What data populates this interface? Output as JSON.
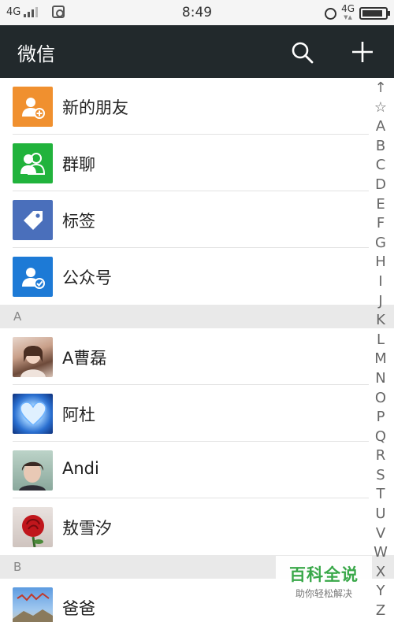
{
  "status_bar": {
    "network_left": "4G",
    "time": "8:49",
    "network_right": "4G"
  },
  "header": {
    "title": "微信"
  },
  "features": [
    {
      "label": "新的朋友",
      "icon": "add-friend-icon",
      "color": "#f0902f"
    },
    {
      "label": "群聊",
      "icon": "group-chat-icon",
      "color": "#21b33c"
    },
    {
      "label": "标签",
      "icon": "tag-icon",
      "color": "#4a6fbb"
    },
    {
      "label": "公众号",
      "icon": "official-account-icon",
      "color": "#1d7ad6"
    }
  ],
  "sections": [
    {
      "letter": "A",
      "contacts": [
        {
          "name": "A曹磊"
        },
        {
          "name": "阿杜"
        },
        {
          "name": "Andi"
        },
        {
          "name": "敖雪汐"
        }
      ]
    },
    {
      "letter": "B",
      "contacts": [
        {
          "name": "爸爸"
        }
      ]
    }
  ],
  "index": [
    "↑",
    "☆",
    "A",
    "B",
    "C",
    "D",
    "E",
    "F",
    "G",
    "H",
    "I",
    "J",
    "K",
    "L",
    "M",
    "N",
    "O",
    "P",
    "Q",
    "R",
    "S",
    "T",
    "U",
    "V",
    "W",
    "X",
    "Y",
    "Z"
  ],
  "watermark": {
    "title": "百科全说",
    "subtitle": "助你轻松解决"
  }
}
